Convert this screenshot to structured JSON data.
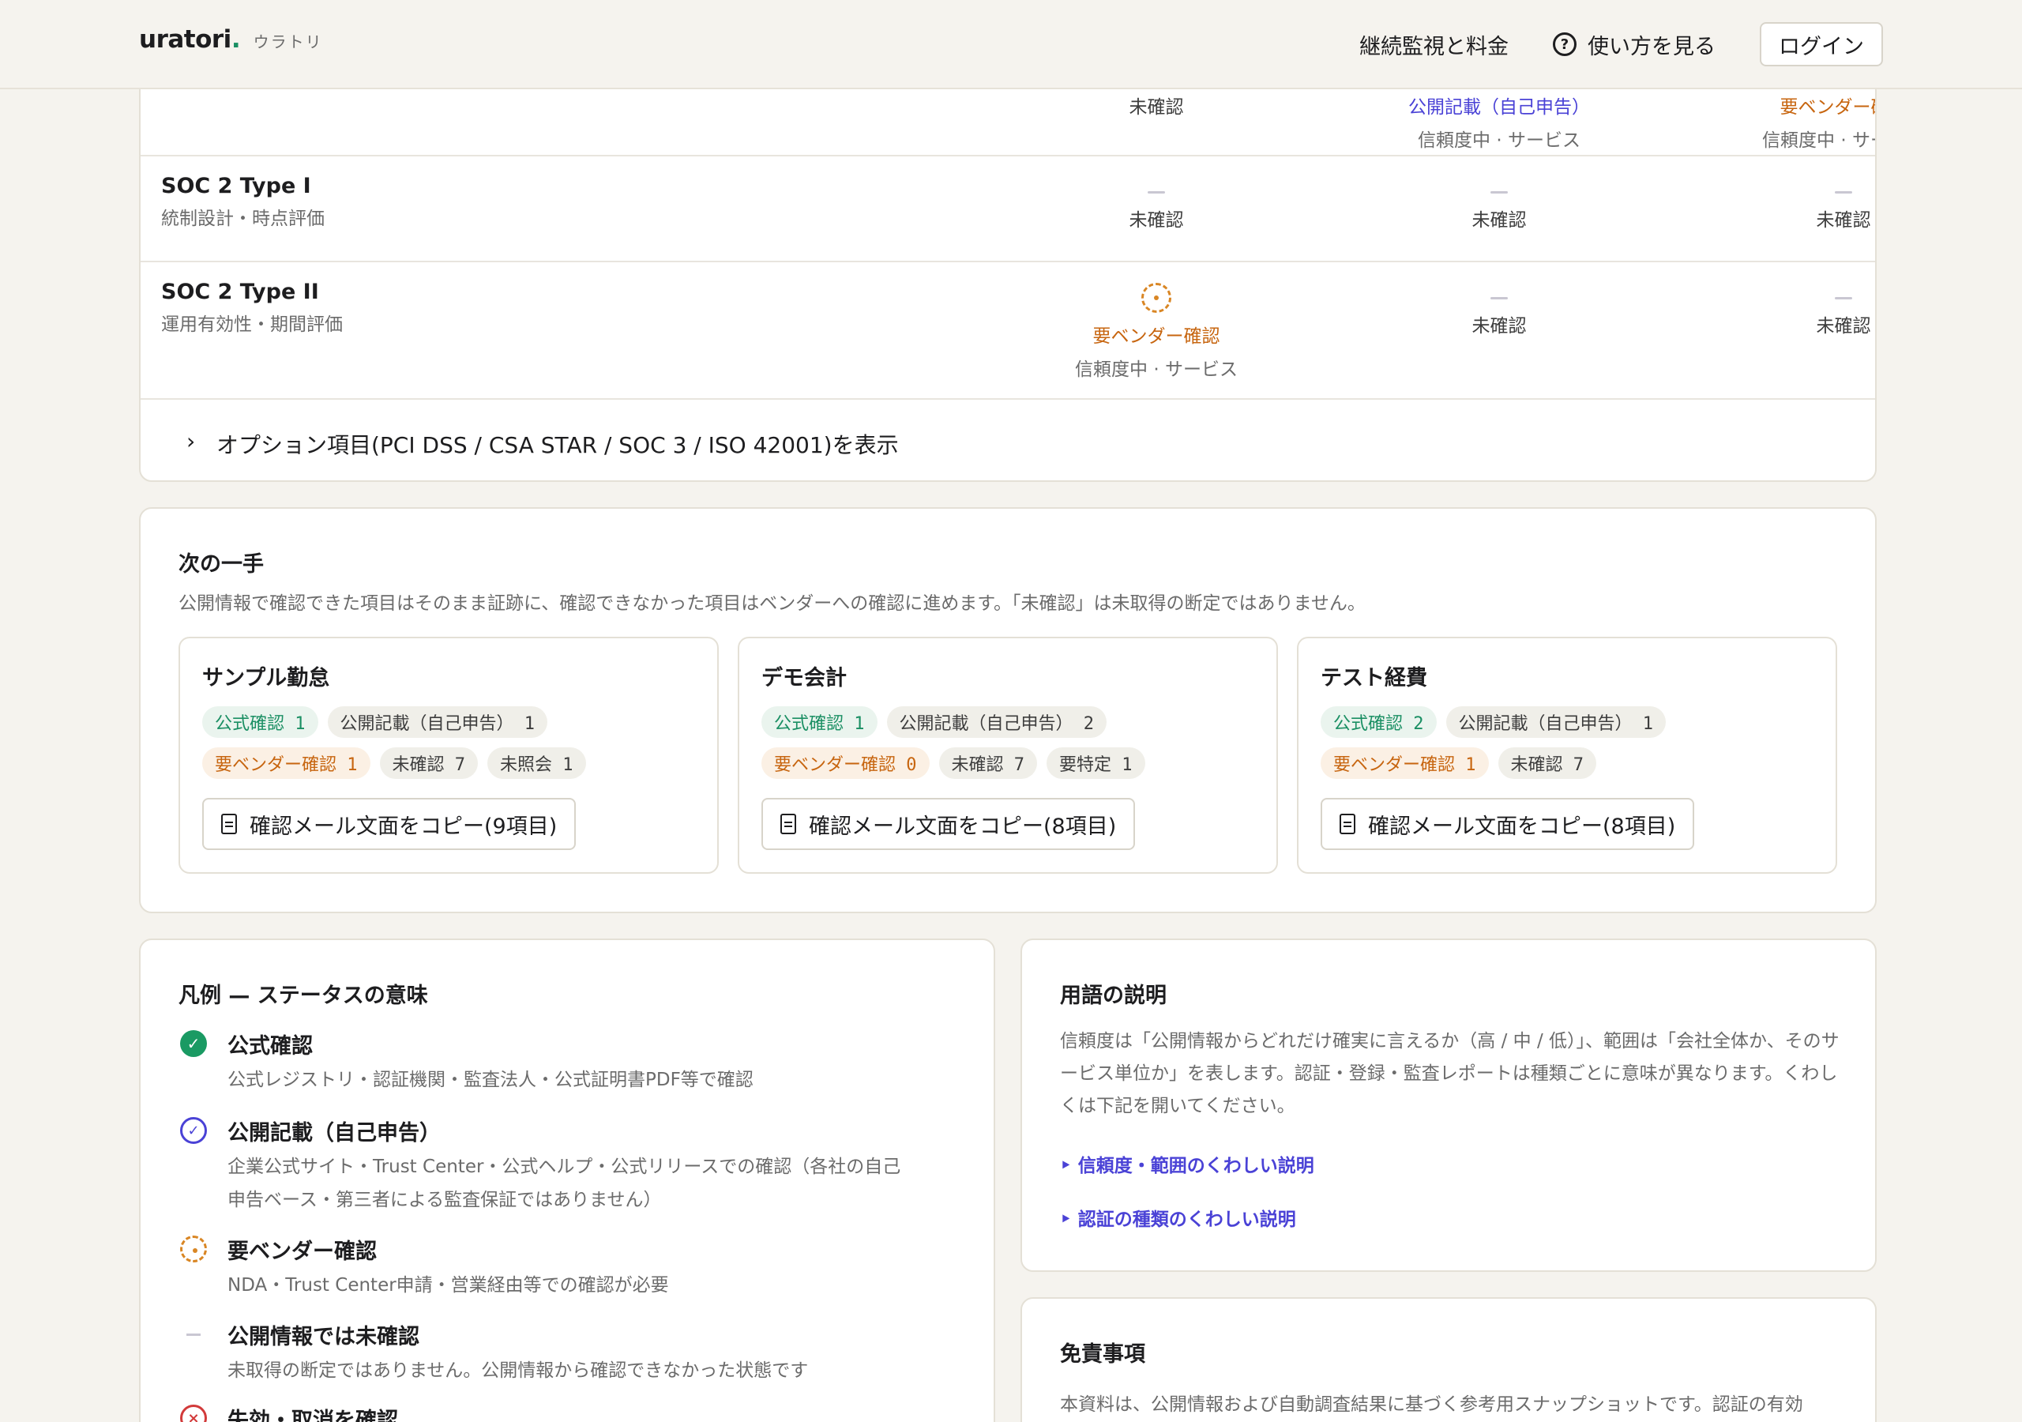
{
  "header": {
    "brand": "uratori",
    "brand_dot": ".",
    "brand_sub": "ウラトリ",
    "nav_pricing": "継続監視と料金",
    "nav_help": "使い方を見る",
    "help_glyph": "?",
    "login": "ログイン"
  },
  "table": {
    "top_row": {
      "cells": [
        {
          "status": "未確認",
          "meta": ""
        },
        {
          "status": "公開記載（自己申告）",
          "meta": "信頼度中 · サービス"
        },
        {
          "status": "要ベンダー確認",
          "meta": "信頼度中 · サービス"
        }
      ]
    },
    "rows": [
      {
        "title": "SOC 2 Type I",
        "sub": "統制設計・時点評価",
        "cells": [
          {
            "status": "未確認",
            "meta": ""
          },
          {
            "status": "未確認",
            "meta": ""
          },
          {
            "status": "未確認",
            "meta": ""
          }
        ]
      },
      {
        "title": "SOC 2 Type II",
        "sub": "運用有効性・期間評価",
        "cells": [
          {
            "status": "要ベンダー確認",
            "meta": "信頼度中 · サービス"
          },
          {
            "status": "未確認",
            "meta": ""
          },
          {
            "status": "未確認",
            "meta": ""
          }
        ]
      }
    ],
    "options_toggle": "オプション項目(PCI DSS / CSA STAR / SOC 3 / ISO 42001)を表示",
    "chevron": "›"
  },
  "next_steps": {
    "title": "次の一手",
    "desc": "公開情報で確認できた項目はそのまま証跡に、確認できなかった項目はベンダーへの確認に進めます。「未確認」は未取得の断定ではありません。",
    "vendors": [
      {
        "name": "サンプル勤怠",
        "chips_row1": [
          "公式確認 1",
          "公開記載（自己申告） 1"
        ],
        "chips_row2": [
          "要ベンダー確認 1",
          "未確認 7",
          "未照会 1"
        ],
        "copy_label": "確認メール文面をコピー(9項目)"
      },
      {
        "name": "デモ会計",
        "chips_row1": [
          "公式確認 1",
          "公開記載（自己申告） 2"
        ],
        "chips_row2": [
          "要ベンダー確認 0",
          "未確認 7",
          "要特定 1"
        ],
        "copy_label": "確認メール文面をコピー(8項目)"
      },
      {
        "name": "テスト経費",
        "chips_row1": [
          "公式確認 2",
          "公開記載（自己申告） 1"
        ],
        "chips_row2": [
          "要ベンダー確認 1",
          "未確認 7"
        ],
        "copy_label": "確認メール文面をコピー(8項目)"
      }
    ]
  },
  "legend": {
    "title": "凡例 — ステータスの意味",
    "items": [
      {
        "name": "公式確認",
        "desc": "公式レジストリ・認証機関・監査法人・公式証明書PDF等で確認"
      },
      {
        "name": "公開記載（自己申告）",
        "desc": "企業公式サイト・Trust Center・公式ヘルプ・公式リリースでの確認（各社の自己申告ベース・第三者による監査保証ではありません）"
      },
      {
        "name": "要ベンダー確認",
        "desc": "NDA・Trust Center申請・営業経由等での確認が必要"
      },
      {
        "name": "公開情報では未確認",
        "desc": "未取得の断定ではありません。公開情報から確認できなかった状態です"
      },
      {
        "name": "失効・取消を確認",
        "desc": ""
      }
    ],
    "glyph_check": "✓",
    "glyph_x": "×"
  },
  "terms": {
    "title": "用語の説明",
    "body": "信頼度は「公開情報からどれだけ確実に言えるか（高 / 中 / 低）」、範囲は「会社全体か、そのサービス単位か」を表します。認証・登録・監査レポートは種類ごとに意味が異なります。くわしくは下記を開いてください。",
    "link1": "‣ 信頼度・範囲のくわしい説明",
    "link2": "‣ 認証の種類のくわしい説明"
  },
  "disclaimer": {
    "title": "免責事項",
    "body": "本資料は、公開情報および自動調査結果に基づく参考用スナップショットです。認証の有効"
  },
  "colors": {
    "accent_green": "#1a8f63",
    "accent_purple": "#4a42d6",
    "accent_orange": "#c7650f",
    "danger": "#d23a3a"
  }
}
